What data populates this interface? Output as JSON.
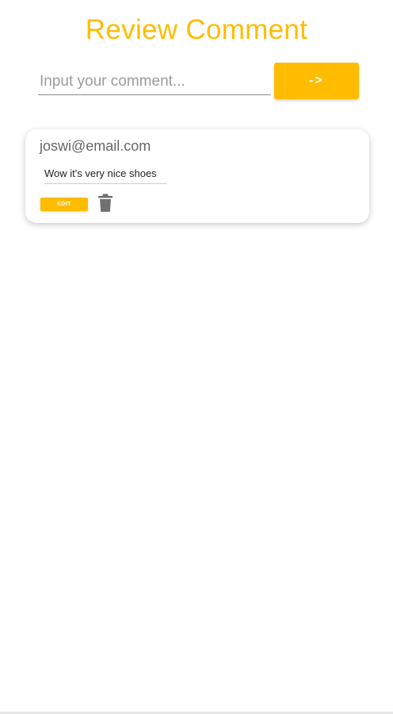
{
  "header": {
    "title": "Review Comment"
  },
  "comment_form": {
    "placeholder": "Input your comment...",
    "value": "",
    "submit_label": "->"
  },
  "comments": [
    {
      "email": "joswi@email.com",
      "text": "Wow it's very nice shoes",
      "edit_label": "EDIT",
      "delete_icon": "trash-icon"
    }
  ],
  "colors": {
    "accent": "#FFBC00",
    "delete_icon": "#707070"
  }
}
